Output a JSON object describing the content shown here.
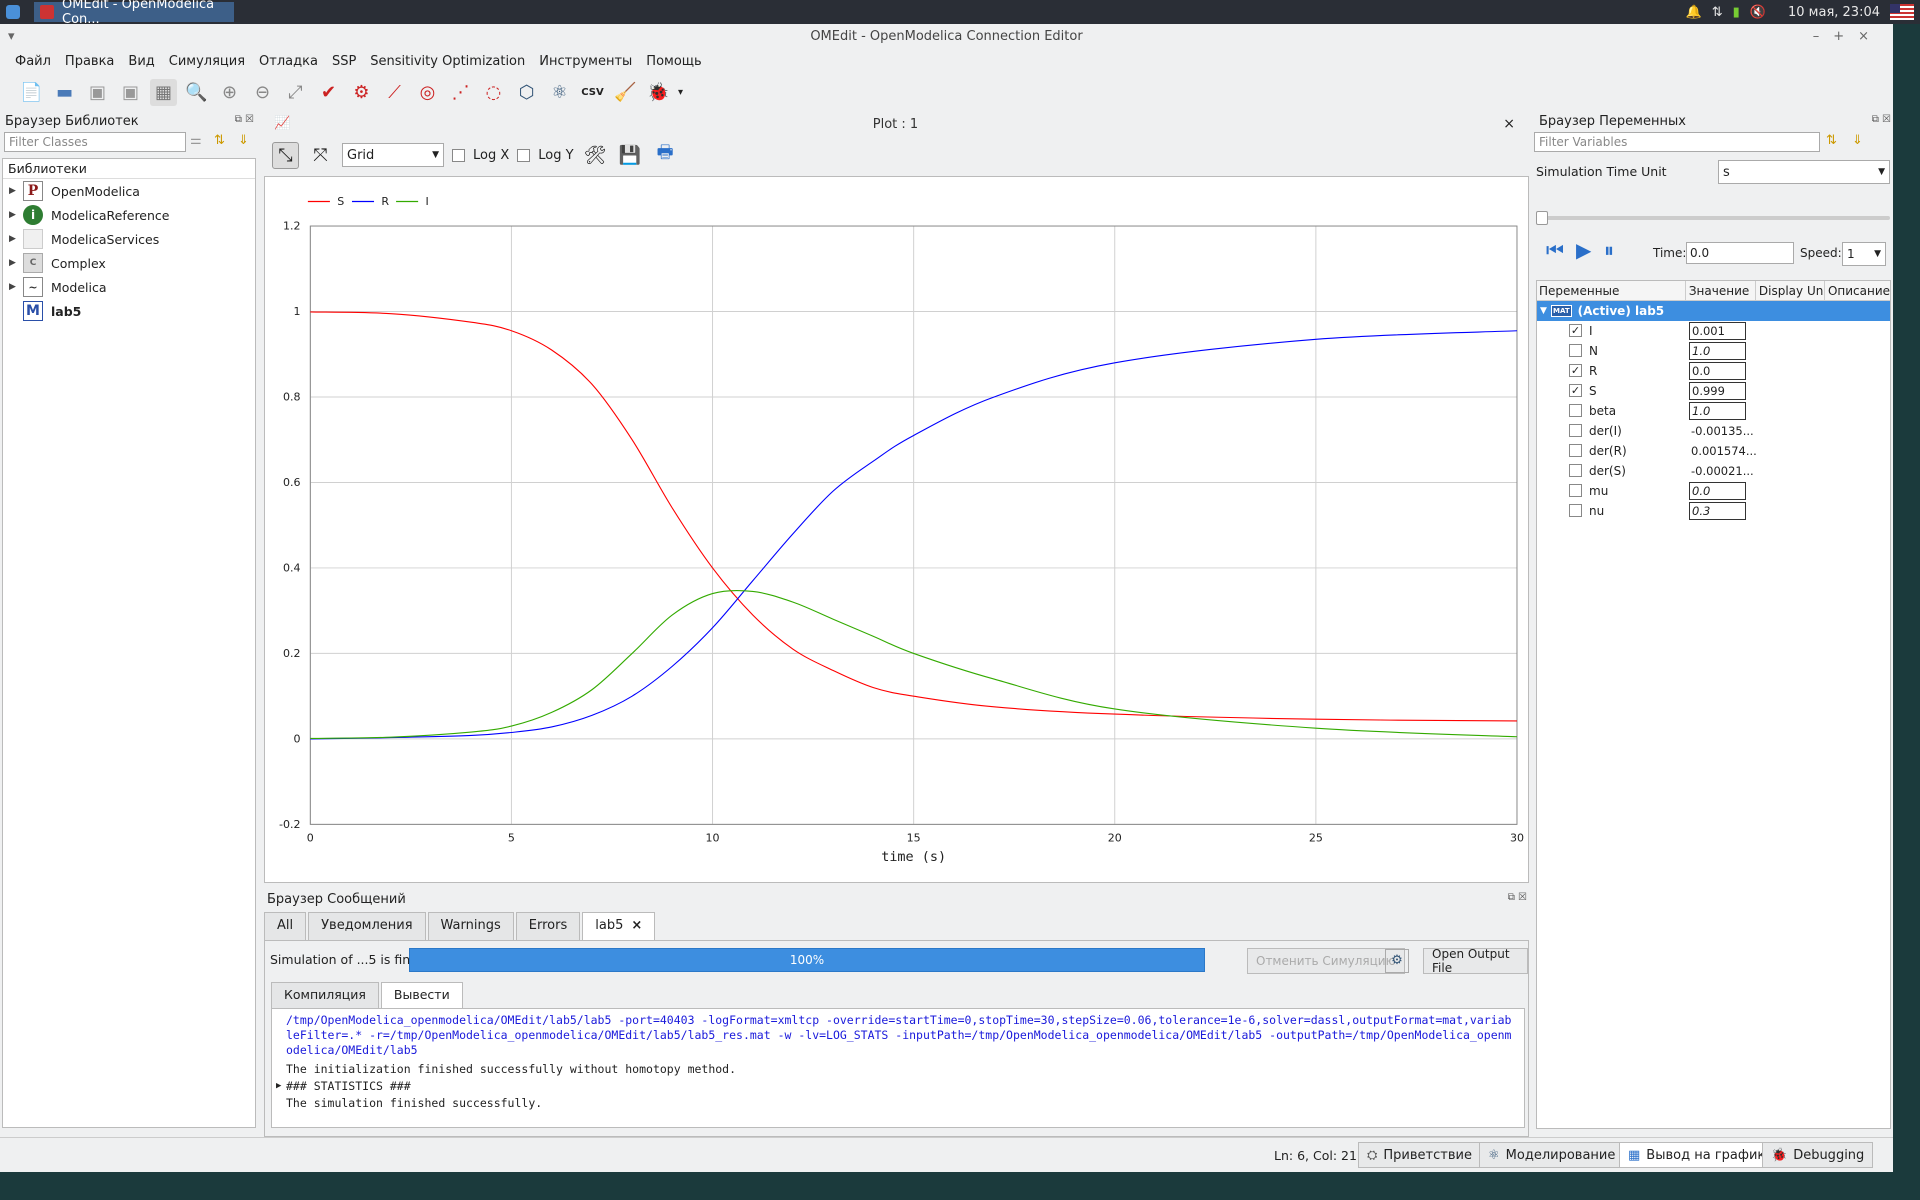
{
  "taskbar": {
    "window_button": "OMEdit - OpenModelica Con...",
    "clock": "10 мая, 23:04"
  },
  "window": {
    "title": "OMEdit - OpenModelica Connection Editor"
  },
  "menu": [
    "Файл",
    "Правка",
    "Вид",
    "Симуляция",
    "Отладка",
    "SSP",
    "Sensitivity Optimization",
    "Инструменты",
    "Помощь"
  ],
  "library": {
    "title": "Браузер Библиотек",
    "filter_placeholder": "Filter Classes",
    "header": "Библиотеки",
    "items": [
      {
        "label": "OpenModelica",
        "icon": "P"
      },
      {
        "label": "ModelicaReference",
        "icon": "i"
      },
      {
        "label": "ModelicaServices",
        "icon": ""
      },
      {
        "label": "Complex",
        "icon": "C"
      },
      {
        "label": "Modelica",
        "icon": "~"
      },
      {
        "label": "lab5",
        "icon": "M"
      }
    ]
  },
  "plot": {
    "title": "Plot : 1",
    "grid_option": "Grid",
    "logx": "Log X",
    "logy": "Log Y"
  },
  "chart_data": {
    "type": "line",
    "xlabel": "time (s)",
    "ylabel": "",
    "xlim": [
      0,
      30
    ],
    "ylim": [
      -0.2,
      1.2
    ],
    "x_ticks": [
      0,
      5,
      10,
      15,
      20,
      25,
      30
    ],
    "y_ticks": [
      -0.2,
      0,
      0.2,
      0.4,
      0.6,
      0.8,
      1,
      1.2
    ],
    "grid": true,
    "legend": "top-left",
    "series": [
      {
        "name": "S",
        "color": "#ff0000",
        "x": [
          0,
          2,
          4,
          5,
          6,
          7,
          8,
          9,
          10,
          11,
          12,
          13,
          14,
          15,
          17,
          20,
          25,
          30
        ],
        "y": [
          0.999,
          0.995,
          0.975,
          0.955,
          0.91,
          0.83,
          0.7,
          0.54,
          0.4,
          0.29,
          0.21,
          0.16,
          0.12,
          0.1,
          0.075,
          0.058,
          0.046,
          0.042
        ]
      },
      {
        "name": "R",
        "color": "#0000ff",
        "x": [
          0,
          2,
          4,
          5,
          6,
          7,
          8,
          9,
          10,
          11,
          12,
          13,
          14,
          15,
          17,
          20,
          25,
          30
        ],
        "y": [
          0,
          0.003,
          0.008,
          0.015,
          0.028,
          0.055,
          0.1,
          0.17,
          0.26,
          0.37,
          0.48,
          0.58,
          0.65,
          0.71,
          0.8,
          0.88,
          0.935,
          0.955
        ]
      },
      {
        "name": "I",
        "color": "#33aa00",
        "x": [
          0,
          2,
          4,
          5,
          6,
          7,
          8,
          9,
          10,
          11,
          12,
          13,
          14,
          15,
          17,
          20,
          25,
          30
        ],
        "y": [
          0.001,
          0.004,
          0.016,
          0.03,
          0.062,
          0.115,
          0.2,
          0.29,
          0.34,
          0.345,
          0.32,
          0.28,
          0.24,
          0.2,
          0.14,
          0.07,
          0.025,
          0.005
        ]
      }
    ]
  },
  "variables": {
    "title": "Браузер Переменных",
    "filter_placeholder": "Filter Variables",
    "time_unit_label": "Simulation Time Unit",
    "time_unit": "s",
    "time_label": "Time:",
    "time_value": "0.0",
    "speed_label": "Speed:",
    "speed_value": "1",
    "headers": [
      "Переменные",
      "Значение",
      "Display Unit",
      "Описание"
    ],
    "root": "(Active) lab5",
    "mat": "MAT",
    "rows": [
      {
        "name": "I",
        "value": "0.001",
        "checked": true,
        "editable": true,
        "italic": false
      },
      {
        "name": "N",
        "value": "1.0",
        "checked": false,
        "editable": true,
        "italic": true
      },
      {
        "name": "R",
        "value": "0.0",
        "checked": true,
        "editable": true,
        "italic": false
      },
      {
        "name": "S",
        "value": "0.999",
        "checked": true,
        "editable": true,
        "italic": false
      },
      {
        "name": "beta",
        "value": "1.0",
        "checked": false,
        "editable": true,
        "italic": true
      },
      {
        "name": "der(I)",
        "value": "-0.00135...",
        "checked": false,
        "editable": false,
        "italic": false
      },
      {
        "name": "der(R)",
        "value": "0.001574...",
        "checked": false,
        "editable": false,
        "italic": false
      },
      {
        "name": "der(S)",
        "value": "-0.00021...",
        "checked": false,
        "editable": false,
        "italic": false
      },
      {
        "name": "mu",
        "value": "0.0",
        "checked": false,
        "editable": true,
        "italic": true
      },
      {
        "name": "nu",
        "value": "0.3",
        "checked": false,
        "editable": true,
        "italic": true
      }
    ]
  },
  "messages": {
    "title": "Браузер Сообщений",
    "tabs": [
      "All",
      "Уведомления",
      "Warnings",
      "Errors",
      "lab5"
    ],
    "status": "Simulation of ...5 is finished.",
    "progress": 1.0,
    "progress_label": "100%",
    "cancel": "Отменить Симуляцию",
    "open_output": "Open Output File",
    "subtabs": [
      "Компиляция",
      "Вывести"
    ],
    "cmd": "/tmp/OpenModelica_openmodelica/OMEdit/lab5/lab5 -port=40403 -logFormat=xmltcp -override=startTime=0,stopTime=30,stepSize=0.06,tolerance=1e-6,solver=dassl,outputFormat=mat,variableFilter=.* -r=/tmp/OpenModelica_openmodelica/OMEdit/lab5/lab5_res.mat -w -lv=LOG_STATS -inputPath=/tmp/OpenModelica_openmodelica/OMEdit/lab5 -outputPath=/tmp/OpenModelica_openmodelica/OMEdit/lab5",
    "line1": "The initialization finished successfully without homotopy method.",
    "line2": "### STATISTICS ###",
    "line3": "The simulation finished successfully."
  },
  "status": {
    "position": "Ln: 6, Col: 21",
    "perspectives": [
      "Приветствие",
      "Моделирование",
      "Вывод на график",
      "Debugging"
    ]
  }
}
